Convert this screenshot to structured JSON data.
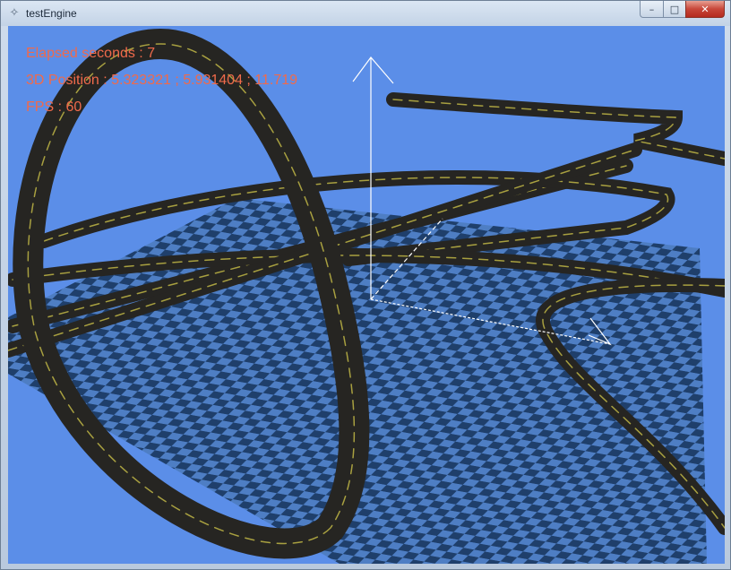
{
  "window": {
    "title": "testEngine",
    "app_icon": "app-icon",
    "buttons": {
      "minimize": "–",
      "maximize": "□",
      "close": "✕"
    }
  },
  "scene": {
    "background_color": "#5b8ee8",
    "floor_dark": "#1f3f6b",
    "floor_light": "#4e7ec4",
    "road_color": "#262522",
    "road_line_color": "#a8a040",
    "axis_color": "#ffffff"
  },
  "hud": {
    "elapsed": "Elapsed seconds : 7",
    "position": "3D Position : 5.323321 ; 5.931404 ; 11.719",
    "fps": "FPS : 60",
    "color": "#f06a4b"
  }
}
